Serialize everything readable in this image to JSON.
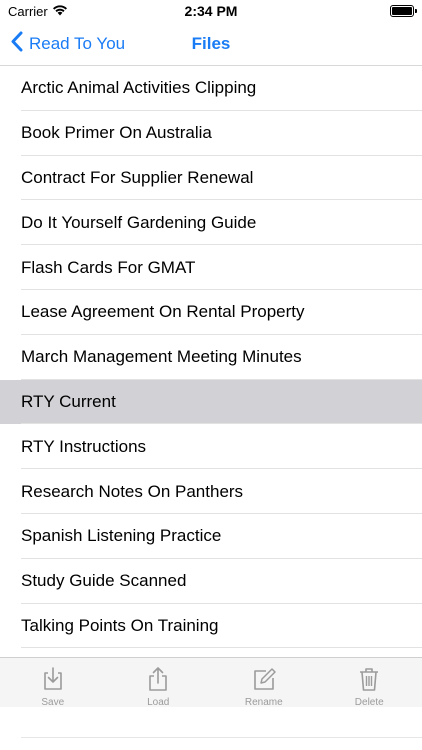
{
  "status_bar": {
    "carrier": "Carrier",
    "time": "2:34 PM"
  },
  "nav": {
    "back_label": "Read To You",
    "title": "Files"
  },
  "files": [
    "Arctic Animal Activities Clipping",
    "Book Primer On Australia",
    "Contract For Supplier Renewal",
    "Do It Yourself Gardening Guide",
    "Flash Cards For GMAT",
    "Lease Agreement On Rental Property",
    "March Management Meeting Minutes",
    "RTY Current",
    "RTY Instructions",
    "Research Notes On Panthers",
    "Spanish Listening Practice",
    "Study Guide Scanned",
    "Talking Points On Training"
  ],
  "selected_file": "RTY Current",
  "toolbar": {
    "save_label": "Save",
    "load_label": "Load",
    "rename_label": "Rename",
    "delete_label": "Delete"
  },
  "colors": {
    "accent": "#1a7cf5",
    "selected_row": "#d1d1d6",
    "toolbar_icon": "#9b9b9b"
  }
}
